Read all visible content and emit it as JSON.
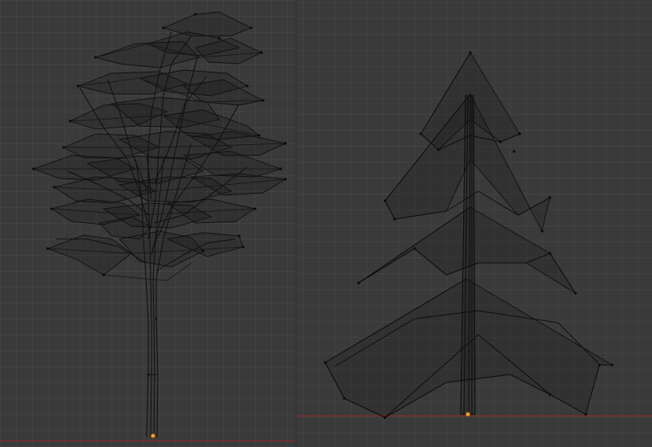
{
  "scene": {
    "viewports": [
      {
        "id": "left",
        "object": "deciduous-tree-wireframe"
      },
      {
        "id": "right",
        "object": "pine-tree-wireframe"
      }
    ],
    "colors": {
      "background": "#3a3a3a",
      "grid": "#444444",
      "wireframe": "#0e0e0e",
      "x_axis": "#8a2a2a",
      "origin": "#f0a030"
    },
    "mode": "wireframe"
  }
}
